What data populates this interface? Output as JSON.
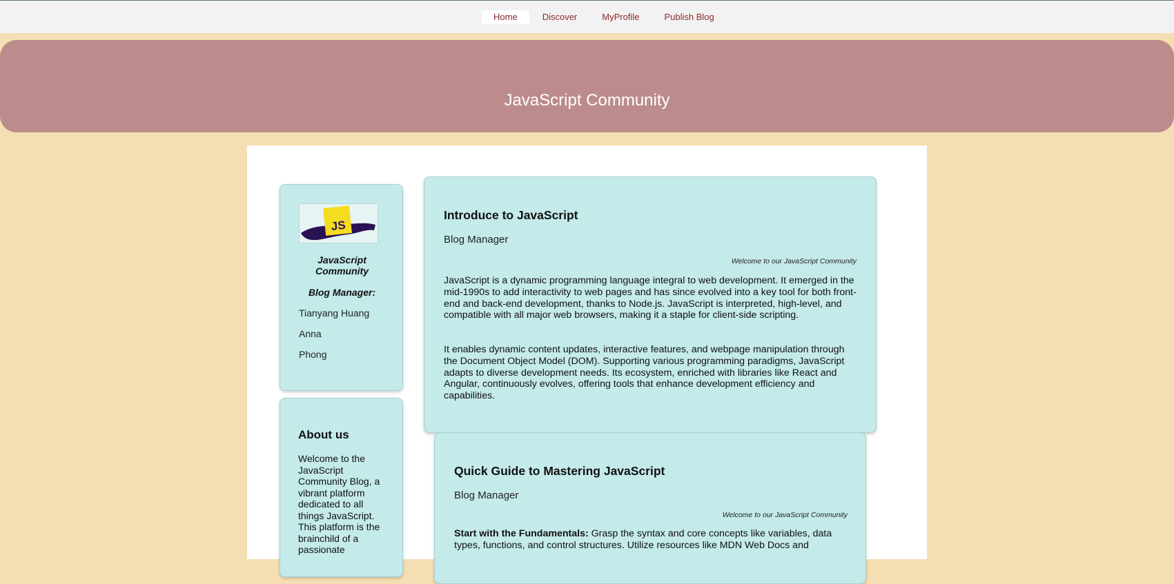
{
  "nav": {
    "items": [
      "Home",
      "Discover",
      "MyProfile",
      "Publish Blog"
    ],
    "active": "Home"
  },
  "banner": {
    "title": "JavaScript Community"
  },
  "sidebar": {
    "logo": {
      "text": "JS",
      "icon": "js-logo",
      "colors": {
        "square": "#f4dc1f",
        "brush": "#2a1154"
      }
    },
    "community_name": "JavaScript Community",
    "managers_heading": "Blog Manager:",
    "managers": [
      "Tianyang Huang",
      "Anna",
      "Phong"
    ],
    "about": {
      "heading": "About us",
      "text": "Welcome to the JavaScript Community Blog, a vibrant platform dedicated to all things JavaScript. This platform is the brainchild of a passionate"
    }
  },
  "posts": [
    {
      "title": "Introduce to JavaScript",
      "author": "Blog Manager",
      "welcome": "Welcome to our JavaScript Community",
      "paragraphs": [
        "JavaScript is a dynamic programming language integral to web development. It emerged in the mid-1990s to add interactivity to web pages and has since evolved into a key tool for both front-end and back-end development, thanks to Node.js. JavaScript is interpreted, high-level, and compatible with all major web browsers, making it a staple for client-side scripting.",
        "It enables dynamic content updates, interactive features, and webpage manipulation through the Document Object Model (DOM). Supporting various programming paradigms, JavaScript adapts to diverse development needs. Its ecosystem, enriched with libraries like React and Angular, continuously evolves, offering tools that enhance development efficiency and capabilities."
      ]
    },
    {
      "title": "Quick Guide to Mastering JavaScript",
      "author": "Blog Manager",
      "welcome": "Welcome to our JavaScript Community",
      "lead_bold": "Start with the Fundamentals:",
      "lead_text": " Grasp the syntax and core concepts like variables, data types, functions, and control structures. Utilize resources like MDN Web Docs and"
    }
  ],
  "colors": {
    "page_bg": "#f5deb3",
    "banner_bg": "#bc8b8b",
    "card_bg": "#c4eaea",
    "nav_link": "#8b2a2a"
  }
}
